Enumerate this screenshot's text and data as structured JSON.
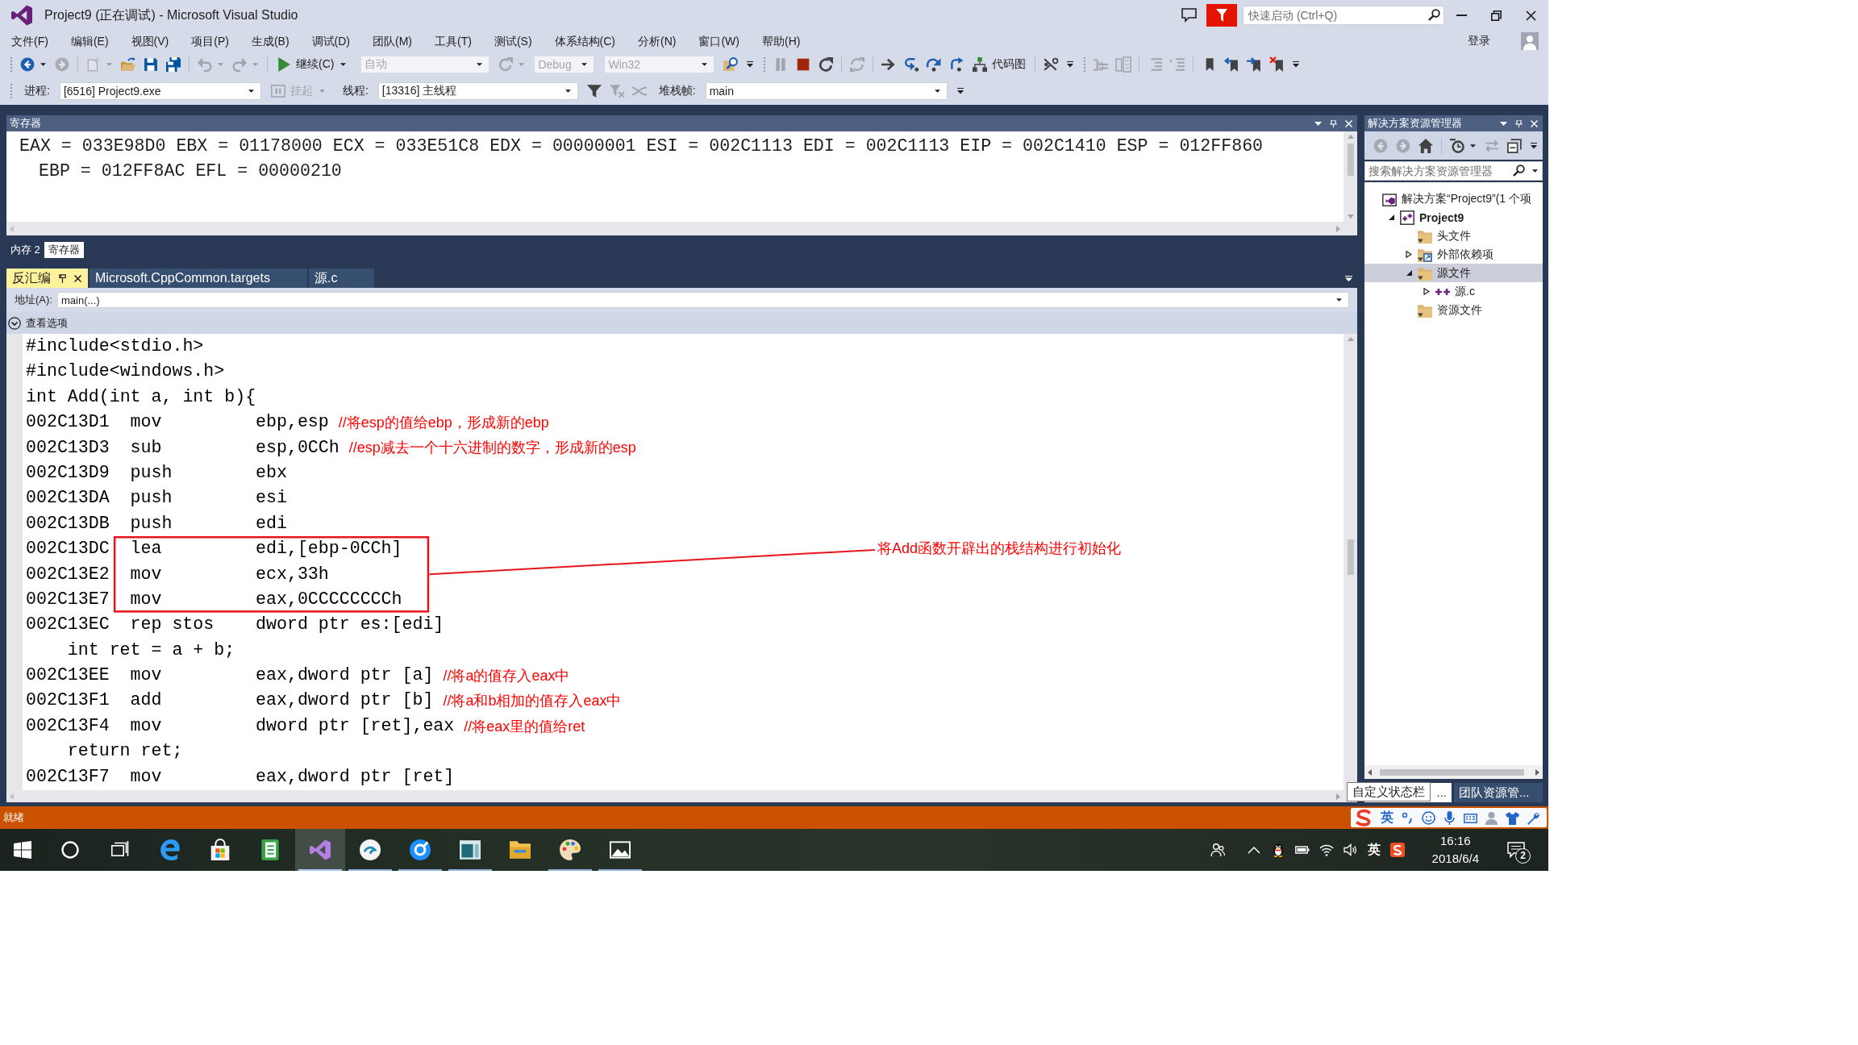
{
  "window": {
    "title": "Project9 (正在调试) - Microsoft Visual Studio",
    "quick_launch": {
      "placeholder": "快速启动 (Ctrl+Q)"
    }
  },
  "menu": {
    "items": [
      "文件(F)",
      "编辑(E)",
      "视图(V)",
      "项目(P)",
      "生成(B)",
      "调试(D)",
      "团队(M)",
      "工具(T)",
      "测试(S)",
      "体系结构(C)",
      "分析(N)",
      "窗口(W)",
      "帮助(H)"
    ],
    "sign_in": "登录"
  },
  "standard_toolbar": [
    {
      "kind": "grip",
      "disabled": false
    },
    {
      "kind": "split",
      "disabled": false
    },
    {
      "kind": "icon",
      "disabled": true
    },
    {
      "kind": "separator"
    },
    {
      "kind": "split",
      "disabled": true
    },
    {
      "kind": "icon",
      "disabled": false
    },
    {
      "kind": "icon",
      "disabled": false
    },
    {
      "kind": "icon",
      "disabled": false
    },
    {
      "kind": "separator"
    },
    {
      "kind": "split",
      "disabled": true
    },
    {
      "kind": "split",
      "disabled": true
    },
    {
      "kind": "separator"
    },
    {
      "kind": "menu_button",
      "label": "继续(C)",
      "disabled": false
    },
    {
      "kind": "combo",
      "label": "自动",
      "disabled": true
    },
    {
      "kind": "split",
      "disabled": true
    },
    {
      "kind": "combo",
      "label": "Debug",
      "disabled": true
    },
    {
      "kind": "combo",
      "label": "Win32",
      "disabled": true
    },
    {
      "kind": "icon",
      "disabled": false
    },
    {
      "kind": "overflow",
      "disabled": false
    },
    {
      "kind": "grip",
      "disabled": false
    },
    {
      "kind": "icon",
      "disabled": true
    },
    {
      "kind": "icon",
      "disabled": false
    },
    {
      "kind": "icon",
      "disabled": false
    },
    {
      "kind": "separator"
    },
    {
      "kind": "icon",
      "disabled": true
    },
    {
      "kind": "separator"
    },
    {
      "kind": "icon",
      "disabled": false
    },
    {
      "kind": "icon",
      "disabled": false
    },
    {
      "kind": "icon",
      "disabled": false
    },
    {
      "kind": "icon",
      "disabled": false
    },
    {
      "kind": "button",
      "label": "代码图",
      "disabled": false
    },
    {
      "kind": "separator"
    },
    {
      "kind": "icon",
      "disabled": false
    },
    {
      "kind": "overflow",
      "disabled": false
    },
    {
      "kind": "grip",
      "disabled": false
    },
    {
      "kind": "icon",
      "disabled": true
    },
    {
      "kind": "icon",
      "disabled": true
    },
    {
      "kind": "separator"
    },
    {
      "kind": "icon",
      "disabled": true
    },
    {
      "kind": "icon",
      "disabled": true
    },
    {
      "kind": "separator"
    },
    {
      "kind": "icon",
      "disabled": false
    },
    {
      "kind": "icon",
      "disabled": false
    },
    {
      "kind": "icon",
      "disabled": false
    },
    {
      "kind": "icon",
      "disabled": false
    },
    {
      "kind": "overflow",
      "disabled": false
    }
  ],
  "debug_location_toolbar": [
    {
      "kind": "grip",
      "disabled": false
    },
    {
      "kind": "label",
      "label": "进程:",
      "disabled": false
    },
    {
      "kind": "combo",
      "label": "[6516] Project9.exe",
      "disabled": false
    },
    {
      "kind": "menu_button",
      "label": "挂起",
      "disabled": true
    },
    {
      "kind": "label",
      "label": "线程:",
      "disabled": false
    },
    {
      "kind": "combo",
      "label": "[13316] 主线程",
      "disabled": false
    },
    {
      "kind": "icon",
      "disabled": false
    },
    {
      "kind": "icon",
      "disabled": true
    },
    {
      "kind": "icon",
      "disabled": true
    },
    {
      "kind": "label",
      "label": "堆栈帧:",
      "disabled": false
    },
    {
      "kind": "combo",
      "label": "main",
      "disabled": false
    },
    {
      "kind": "overflow",
      "disabled": false
    }
  ],
  "registers_window": {
    "title": "寄存器",
    "registers": [
      "EAX = 033E98D0",
      "EBX = 01178000",
      "ECX = 033E51C8",
      "EDX = 00000001",
      "ESI = 002C1113",
      "EDI = 002C1113",
      "EIP = 002C1410",
      "ESP = 012FF860",
      "EBP = 012FF8AC",
      "EFL = 00000210"
    ]
  },
  "tool_tabs": [
    {
      "label": "内存 2",
      "selected": false
    },
    {
      "label": "寄存器",
      "selected": true
    }
  ],
  "document_tabs": [
    {
      "label": "反汇编",
      "selected": true
    },
    {
      "label": "Microsoft.CppCommon.targets",
      "selected": false
    },
    {
      "label": "源.c",
      "selected": false
    }
  ],
  "disassembly": {
    "address_label": "地址(A):",
    "address": "main(...)",
    "view_options": "查看选项",
    "lines": [
      {
        "kind": "source",
        "text": "#include<stdio.h>",
        "boxed": false
      },
      {
        "kind": "source",
        "text": "#include<windows.h>",
        "boxed": false
      },
      {
        "kind": "source",
        "text": "int Add(int a, int b){",
        "boxed": false
      },
      {
        "kind": "asm",
        "address": "002C13D1",
        "mnemonic": "mov",
        "operands": "ebp,esp",
        "comment": "//将esp的值给ebp，形成新的ebp",
        "boxed": false
      },
      {
        "kind": "asm",
        "address": "002C13D3",
        "mnemonic": "sub",
        "operands": "esp,0CCh",
        "comment": "//esp减去一个十六进制的数字，形成新的esp",
        "boxed": false
      },
      {
        "kind": "asm",
        "address": "002C13D9",
        "mnemonic": "push",
        "operands": "ebx",
        "boxed": false
      },
      {
        "kind": "asm",
        "address": "002C13DA",
        "mnemonic": "push",
        "operands": "esi",
        "boxed": false
      },
      {
        "kind": "asm",
        "address": "002C13DB",
        "mnemonic": "push",
        "operands": "edi",
        "boxed": false
      },
      {
        "kind": "asm",
        "address": "002C13DC",
        "mnemonic": "lea",
        "operands": "edi,[ebp-0CCh]",
        "boxed": true
      },
      {
        "kind": "asm",
        "address": "002C13E2",
        "mnemonic": "mov",
        "operands": "ecx,33h",
        "boxed": true
      },
      {
        "kind": "asm",
        "address": "002C13E7",
        "mnemonic": "mov",
        "operands": "eax,0CCCCCCCCh",
        "boxed": true
      },
      {
        "kind": "asm",
        "address": "002C13EC",
        "mnemonic": "rep stos",
        "operands": "dword ptr es:[edi]",
        "boxed": false
      },
      {
        "kind": "statement",
        "text": "int ret = a + b;",
        "boxed": false
      },
      {
        "kind": "asm",
        "address": "002C13EE",
        "mnemonic": "mov",
        "operands": "eax,dword ptr [a]",
        "comment": "//将a的值存入eax中",
        "boxed": false
      },
      {
        "kind": "asm",
        "address": "002C13F1",
        "mnemonic": "add",
        "operands": "eax,dword ptr [b]",
        "comment": "//将a和b相加的值存入eax中",
        "boxed": false
      },
      {
        "kind": "asm",
        "address": "002C13F4",
        "mnemonic": "mov",
        "operands": "dword ptr [ret],eax",
        "comment": "//将eax里的值给ret",
        "boxed": false
      },
      {
        "kind": "statement",
        "text": "return ret;",
        "boxed": false
      },
      {
        "kind": "asm",
        "address": "002C13F7",
        "mnemonic": "mov",
        "operands": "eax,dword ptr [ret]",
        "boxed": false
      }
    ],
    "callout": "将Add函数开辟出的栈结构进行初始化"
  },
  "solution_explorer": {
    "title": "解决方案资源管理器",
    "toolbar": [
      {
        "kind": "icon",
        "disabled": true
      },
      {
        "kind": "icon",
        "disabled": true
      },
      {
        "kind": "icon",
        "disabled": false
      },
      {
        "kind": "separator"
      },
      {
        "kind": "split",
        "disabled": false
      },
      {
        "kind": "icon",
        "disabled": true
      },
      {
        "kind": "icon",
        "disabled": false
      },
      {
        "kind": "overflow",
        "disabled": false
      }
    ],
    "search": {
      "placeholder": "搜索解决方案资源管理器"
    },
    "tree": [
      {
        "kind": "solution",
        "label": "解决方案“Project9”(1 个项",
        "selected": false,
        "children": [
          {
            "kind": "project",
            "label": "Project9",
            "expanded": true,
            "selected": false,
            "children": [
              {
                "kind": "folder",
                "label": "头文件",
                "selected": false
              },
              {
                "kind": "references",
                "label": "外部依赖项",
                "expanded": false,
                "selected": false
              },
              {
                "kind": "folder",
                "label": "源文件",
                "expanded": true,
                "selected": true,
                "children": [
                  {
                    "kind": "source",
                    "label": "源.c",
                    "expanded": false,
                    "selected": false
                  }
                ]
              },
              {
                "kind": "folder",
                "label": "资源文件",
                "selected": false
              }
            ]
          }
        ]
      }
    ],
    "tabs": [
      {
        "label": "...",
        "selected": true
      },
      {
        "label": "团队资源管...",
        "selected": false
      }
    ],
    "tooltip": "自定义状态栏"
  },
  "status_bar": {
    "text": "就绪",
    "ime_mode": "英"
  },
  "taskbar": {
    "apps": [
      {
        "running": false,
        "selected": false
      },
      {
        "running": false,
        "selected": false
      },
      {
        "running": false,
        "selected": false
      },
      {
        "running": true,
        "selected": true
      },
      {
        "running": true,
        "selected": false
      },
      {
        "running": true,
        "selected": false
      },
      {
        "running": true,
        "selected": false
      },
      {
        "running": false,
        "selected": false
      },
      {
        "running": true,
        "selected": false
      },
      {
        "running": true,
        "selected": false
      }
    ],
    "ime_mode": "英",
    "time": "16:16",
    "date": "2018/6/4",
    "notification_count": "2"
  }
}
